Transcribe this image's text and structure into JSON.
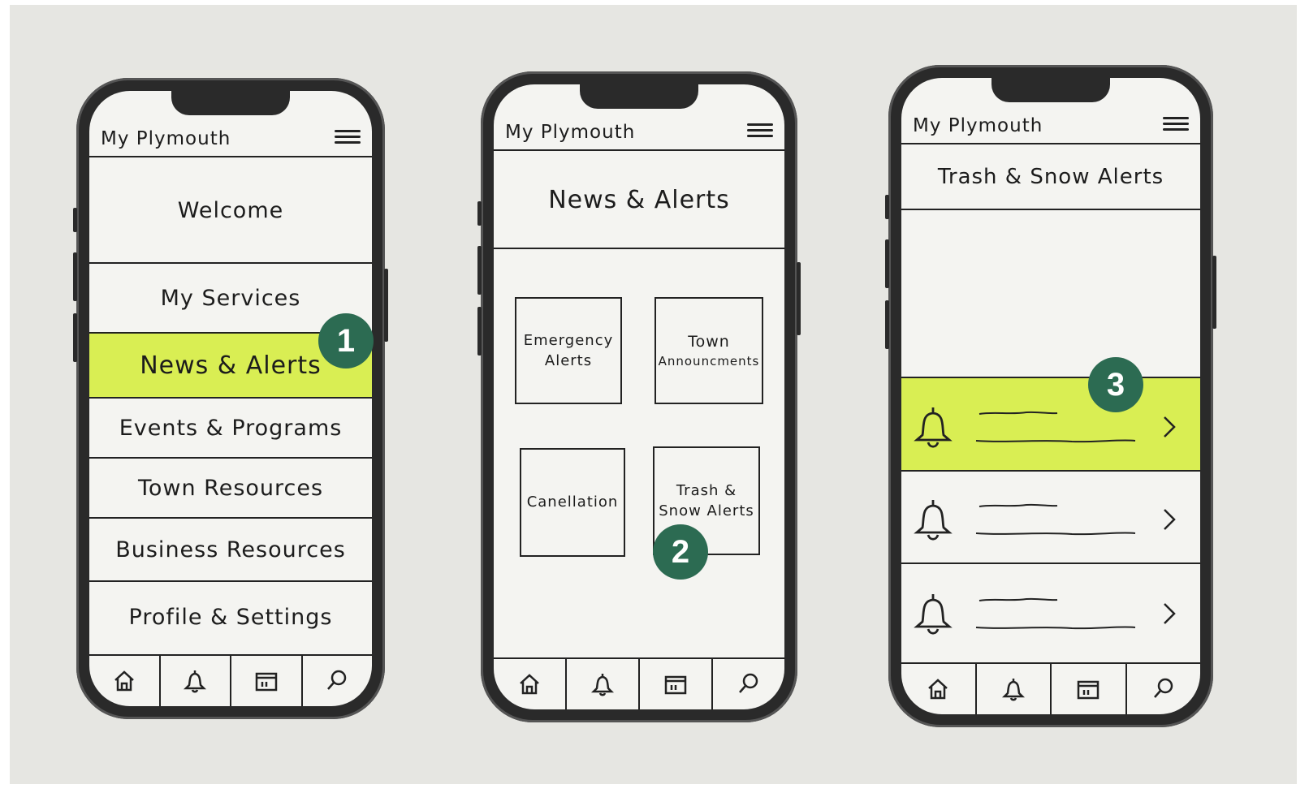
{
  "colors": {
    "highlight": "#d9ee53",
    "badge": "#2c6b52",
    "ink": "#1c1c1c",
    "paper": "#e6e6e2"
  },
  "phone1": {
    "app_title": "My Plymouth",
    "menu_icon": "hamburger-icon",
    "menu_items": [
      {
        "label": "Welcome"
      },
      {
        "label": "My Services"
      },
      {
        "label": "News & Alerts"
      },
      {
        "label": "Events & Programs"
      },
      {
        "label": "Town Resources"
      },
      {
        "label": "Business Resources"
      },
      {
        "label": "Profile & Settings"
      }
    ],
    "badge": "1"
  },
  "phone2": {
    "app_title": "My Plymouth",
    "page_title": "News & Alerts",
    "tiles": [
      {
        "label_line1": "Emergency",
        "label_line2": "Alerts"
      },
      {
        "label_line1": "Town",
        "label_line2": "Announcments"
      },
      {
        "label_line1": "Canellation",
        "label_line2": ""
      },
      {
        "label_line1": "Trash &",
        "label_line2": "Snow Alerts"
      }
    ],
    "badge": "2"
  },
  "phone3": {
    "app_title": "My Plymouth",
    "page_title": "Trash & Snow Alerts",
    "alerts": [
      {
        "icon": "bell-icon",
        "highlighted": true
      },
      {
        "icon": "bell-icon",
        "highlighted": false
      },
      {
        "icon": "bell-icon",
        "highlighted": false
      }
    ],
    "badge": "3"
  },
  "tabbar_icons": [
    "home-icon",
    "bell-icon",
    "calendar-icon",
    "search-icon"
  ]
}
